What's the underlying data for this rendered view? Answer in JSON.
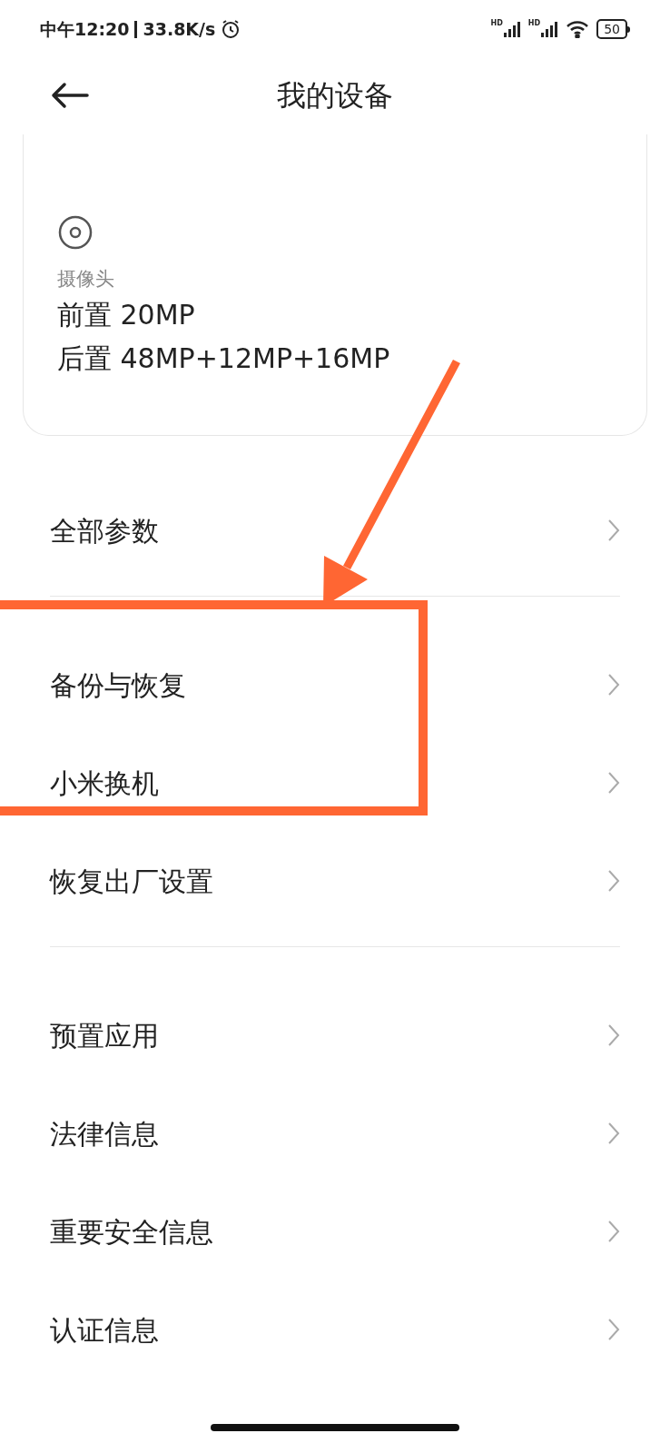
{
  "status_bar": {
    "time": "中午12:20",
    "speed": "33.8K/s",
    "signal_labels": [
      "HD",
      "HD"
    ],
    "battery": "50"
  },
  "header": {
    "title": "我的设备"
  },
  "camera_card": {
    "label": "摄像头",
    "lines": [
      "前置 20MP",
      "后置 48MP+12MP+16MP"
    ]
  },
  "groups": [
    {
      "items": [
        {
          "label": "全部参数"
        }
      ]
    },
    {
      "items": [
        {
          "label": "备份与恢复"
        },
        {
          "label": "小米换机"
        },
        {
          "label": "恢复出厂设置"
        }
      ]
    },
    {
      "items": [
        {
          "label": "预置应用"
        },
        {
          "label": "法律信息"
        },
        {
          "label": "重要安全信息"
        },
        {
          "label": "认证信息"
        }
      ]
    }
  ]
}
